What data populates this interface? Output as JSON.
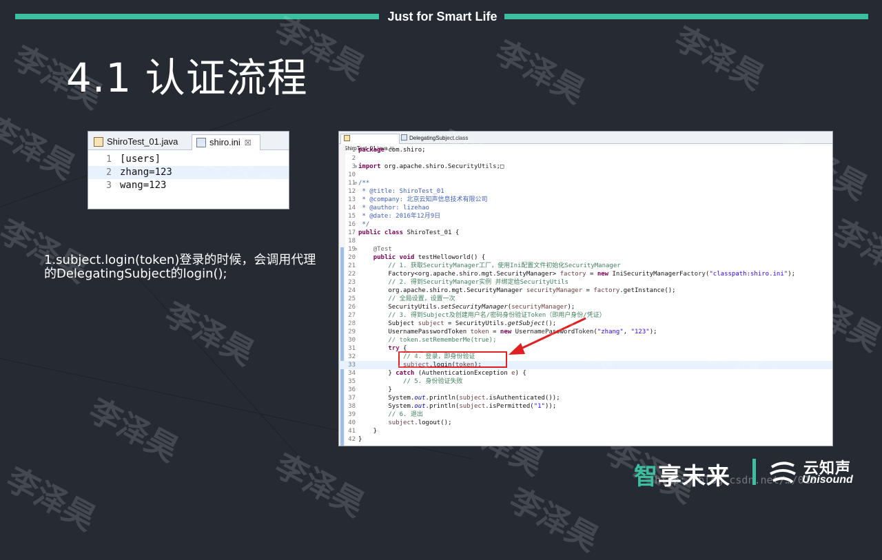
{
  "header": {
    "tagline": "Just for Smart Life"
  },
  "title": "4.1 认证流程",
  "ini_editor": {
    "tabs": [
      {
        "label": "ShiroTest_01.java",
        "icon": "java-file-icon",
        "active": false
      },
      {
        "label": "shiro.ini",
        "icon": "ini-file-icon",
        "active": true,
        "close": "☒"
      }
    ],
    "lines": [
      {
        "n": "1",
        "text": "[users]"
      },
      {
        "n": "2",
        "text": "zhang=123"
      },
      {
        "n": "3",
        "text": "wang=123"
      }
    ]
  },
  "description": "1.subject.login(token)登录的时候，会调用代理的DelegatingSubject的login();",
  "code_editor": {
    "tabs": [
      {
        "label": "ShiroTest_01.java",
        "active": true,
        "close": "☒"
      },
      {
        "label": "DelegatingSubject.class",
        "active": false
      }
    ],
    "lines": [
      {
        "n": "1",
        "fold": "",
        "html": "<span class=\"kw\">package</span> com.shiro;"
      },
      {
        "n": "2",
        "fold": "",
        "html": ""
      },
      {
        "n": "3",
        "fold": "⊕",
        "html": "<span class=\"kw\">import</span> org.apache.shiro.SecurityUtils;□"
      },
      {
        "n": "10",
        "fold": "",
        "html": ""
      },
      {
        "n": "11",
        "fold": "⊖",
        "html": "<span class=\"jd\">/**</span>"
      },
      {
        "n": "12",
        "fold": "",
        "html": "<span class=\"jd\"> * @title: ShiroTest_01</span>"
      },
      {
        "n": "13",
        "fold": "",
        "html": "<span class=\"jd\"> * @company: 北京云知声信息技术有限公司</span>"
      },
      {
        "n": "14",
        "fold": "",
        "html": "<span class=\"jd\"> * @author: lizehao</span>"
      },
      {
        "n": "15",
        "fold": "",
        "html": "<span class=\"jd\"> * @date: 2016年12月9日</span>"
      },
      {
        "n": "16",
        "fold": "",
        "html": "<span class=\"jd\"> */</span>"
      },
      {
        "n": "17",
        "fold": "",
        "html": "<span class=\"kw\">public class</span> ShiroTest_01 {"
      },
      {
        "n": "18",
        "fold": "",
        "html": ""
      },
      {
        "n": "19",
        "fold": "⊖",
        "html": "    <span class=\"ann\">@Test</span>"
      },
      {
        "n": "20",
        "fold": "",
        "html": "    <span class=\"kw\">public void</span> testHelloworld() {"
      },
      {
        "n": "21",
        "fold": "",
        "html": "        <span class=\"cm\">// 1. 获取SecurityManager工厂，使用Ini配置文件初始化SecurityManager</span>"
      },
      {
        "n": "22",
        "fold": "",
        "html": "        Factory&lt;org.apache.shiro.mgt.SecurityManager&gt; <span class=\"vr\">factory</span> = <span class=\"kw\">new</span> IniSecurityManagerFactory(<span class=\"st\">\"classpath:shiro.ini\"</span>);"
      },
      {
        "n": "23",
        "fold": "",
        "html": "        <span class=\"cm\">// 2. 得到SecurityManager实例 并绑定给SecurityUtils</span>"
      },
      {
        "n": "24",
        "fold": "",
        "html": "        org.apache.shiro.mgt.SecurityManager <span class=\"vr\">securityManager</span> = <span class=\"vr\">factory</span>.getInstance();"
      },
      {
        "n": "25",
        "fold": "",
        "html": "        <span class=\"cm\">// 全局设置，设置一次</span>"
      },
      {
        "n": "26",
        "fold": "",
        "html": "        SecurityUtils.<span class=\"it\">setSecurityManager</span>(<span class=\"vr\">securityManager</span>);"
      },
      {
        "n": "27",
        "fold": "",
        "html": "        <span class=\"cm\">// 3. 得到Subject及创建用户名/密码身份验证Token（即用户身份/凭证）</span>"
      },
      {
        "n": "28",
        "fold": "",
        "html": "        Subject <span class=\"vr\">subject</span> = SecurityUtils.<span class=\"it\">getSubject</span>();"
      },
      {
        "n": "29",
        "fold": "",
        "html": "        UsernamePasswordToken <span class=\"vr\">token</span> = <span class=\"kw\">new</span> UsernamePasswordToken(<span class=\"st\">\"zhang\"</span>, <span class=\"st\">\"123\"</span>);"
      },
      {
        "n": "30",
        "fold": "",
        "html": "        <span class=\"cm\">// token.setRememberMe(true);</span>"
      },
      {
        "n": "31",
        "fold": "",
        "html": "        <span class=\"kw\">try</span> {"
      },
      {
        "n": "32",
        "fold": "",
        "html": "            <span class=\"cm\">// 4. 登录，即身份验证</span>"
      },
      {
        "n": "33",
        "fold": "",
        "html": "            <span class=\"vr\">subject</span>.login(<span class=\"vr\">token</span>);",
        "hl": true
      },
      {
        "n": "34",
        "fold": "",
        "html": "        } <span class=\"kw\">catch</span> (AuthenticationException <span class=\"vr\">e</span>) {"
      },
      {
        "n": "35",
        "fold": "",
        "html": "            <span class=\"cm\">// 5. 身份验证失败</span>"
      },
      {
        "n": "36",
        "fold": "",
        "html": "        }"
      },
      {
        "n": "37",
        "fold": "",
        "html": "        System.<span class=\"fld\">out</span>.println(<span class=\"vr\">subject</span>.isAuthenticated());"
      },
      {
        "n": "38",
        "fold": "",
        "html": "        System.<span class=\"fld\">out</span>.println(<span class=\"vr\">subject</span>.isPermitted(<span class=\"st\">\"1\"</span>));"
      },
      {
        "n": "39",
        "fold": "",
        "html": "        <span class=\"cm\">// 6. 退出</span>"
      },
      {
        "n": "40",
        "fold": "",
        "html": "        <span class=\"vr\">subject</span>.logout();"
      },
      {
        "n": "41",
        "fold": "",
        "html": "    }"
      },
      {
        "n": "42",
        "fold": "",
        "html": "}"
      }
    ]
  },
  "watermark": {
    "text": "李泽昊",
    "url": "http://blog.csdn.net/…/010"
  },
  "footer": {
    "slogan_accent": "智",
    "slogan_rest": "享未来",
    "logo_cn": "云知声",
    "logo_en": "Unisound"
  },
  "colors": {
    "background": "#262b33",
    "accent": "#3bbfa0",
    "highlight_box": "#e02020"
  }
}
